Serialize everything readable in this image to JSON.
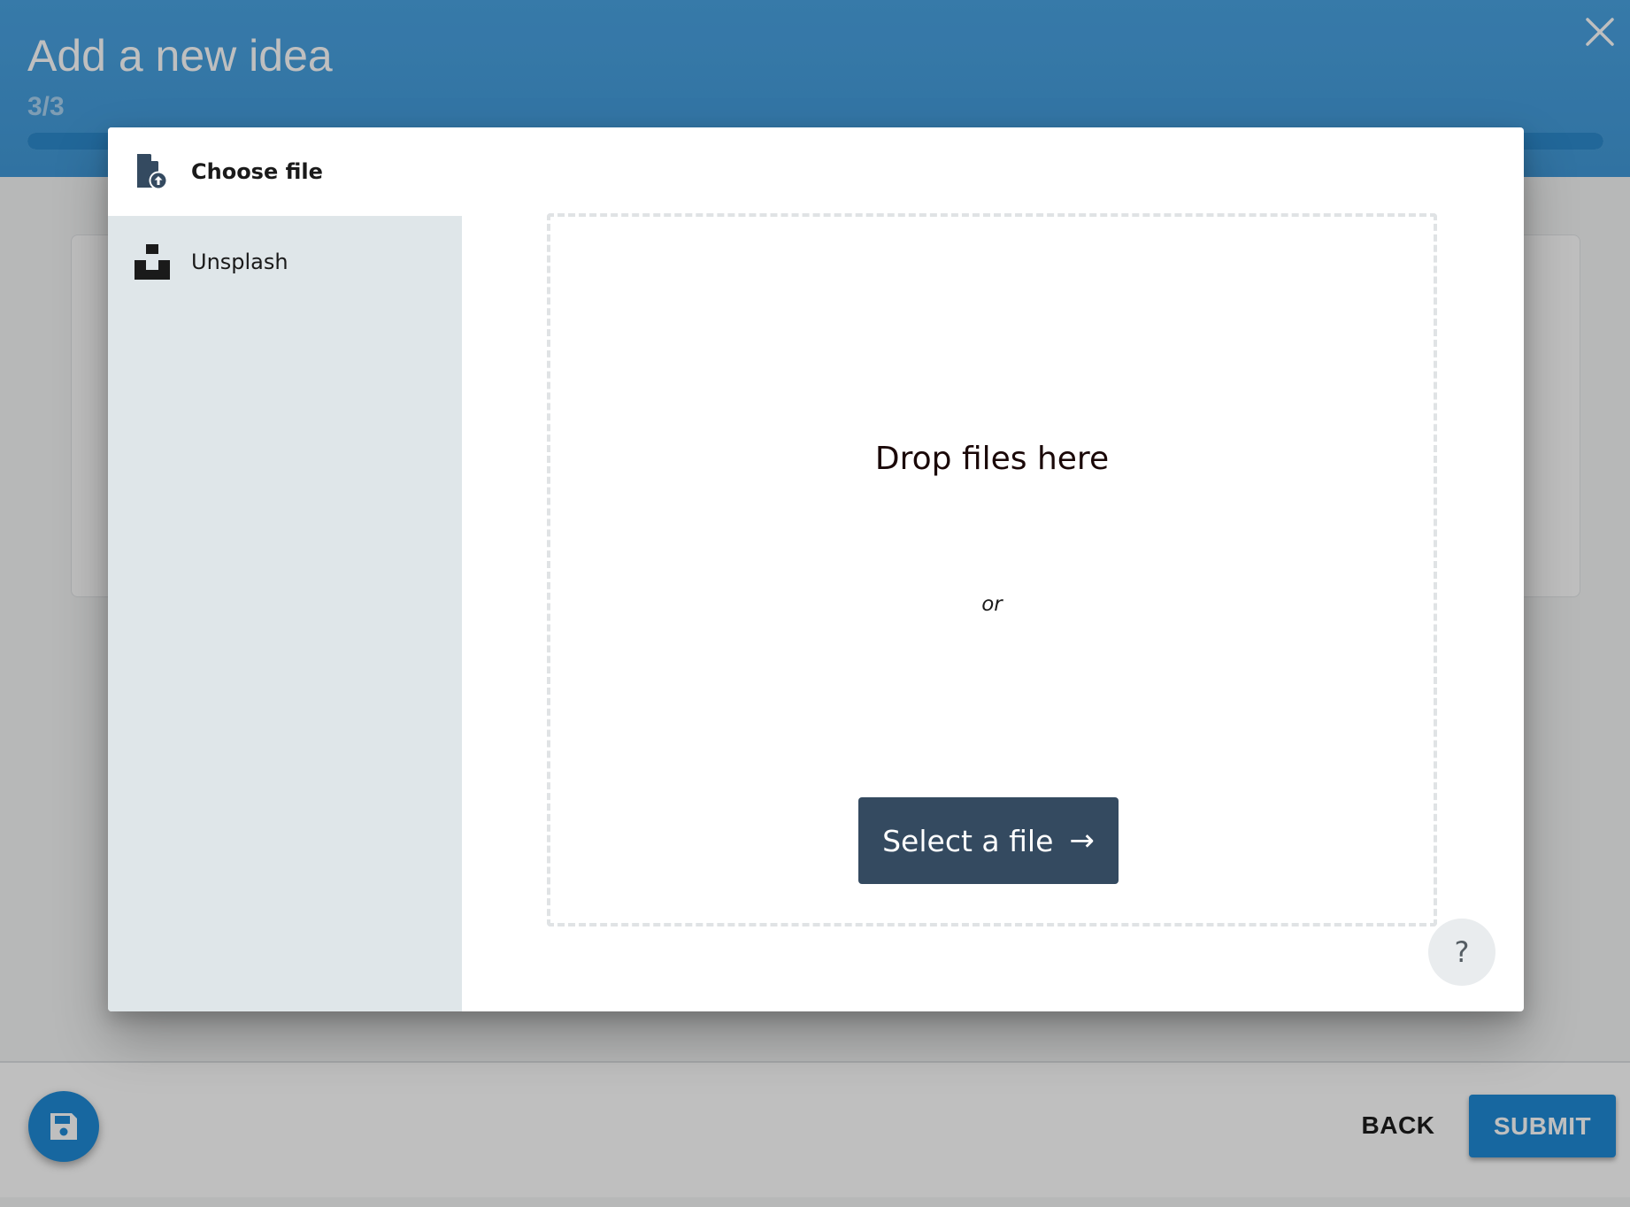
{
  "wizard": {
    "title": "Add a new idea",
    "step": "3/3",
    "progress_fraction": 1.0,
    "close_icon": "close-icon"
  },
  "footer": {
    "save_icon": "floppy-disk-icon",
    "back_label": "BACK",
    "submit_label": "SUBMIT"
  },
  "upload_modal": {
    "sources": [
      {
        "label": "Choose file",
        "icon": "file-upload-icon",
        "active": true
      },
      {
        "label": "Unsplash",
        "icon": "unsplash-logo-icon",
        "active": false
      }
    ],
    "drop_title": "Drop files here",
    "or_text": "or",
    "select_button_label": "Select a file",
    "select_button_icon": "arrow-right-icon",
    "help_label": "?"
  },
  "colors": {
    "header_blue": "#4199d8",
    "accent_blue": "#1f8ad6",
    "button_dark": "#344a60",
    "sidebar_bg": "#dfe6e9"
  }
}
